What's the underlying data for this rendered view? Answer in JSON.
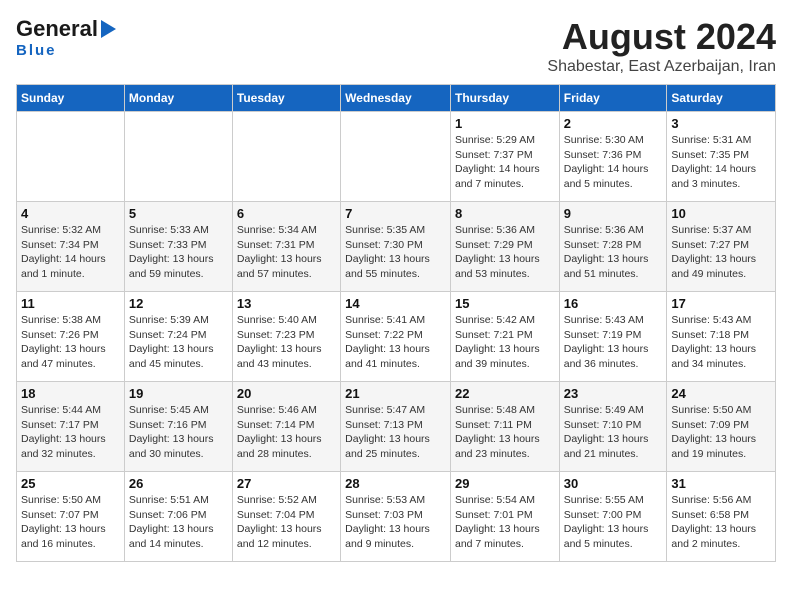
{
  "logo": {
    "line1": "General",
    "line2": "Blue"
  },
  "header": {
    "title": "August 2024",
    "subtitle": "Shabestar, East Azerbaijan, Iran"
  },
  "days_of_week": [
    "Sunday",
    "Monday",
    "Tuesday",
    "Wednesday",
    "Thursday",
    "Friday",
    "Saturday"
  ],
  "weeks": [
    [
      {
        "day": "",
        "info": ""
      },
      {
        "day": "",
        "info": ""
      },
      {
        "day": "",
        "info": ""
      },
      {
        "day": "",
        "info": ""
      },
      {
        "day": "1",
        "info": "Sunrise: 5:29 AM\nSunset: 7:37 PM\nDaylight: 14 hours\nand 7 minutes."
      },
      {
        "day": "2",
        "info": "Sunrise: 5:30 AM\nSunset: 7:36 PM\nDaylight: 14 hours\nand 5 minutes."
      },
      {
        "day": "3",
        "info": "Sunrise: 5:31 AM\nSunset: 7:35 PM\nDaylight: 14 hours\nand 3 minutes."
      }
    ],
    [
      {
        "day": "4",
        "info": "Sunrise: 5:32 AM\nSunset: 7:34 PM\nDaylight: 14 hours\nand 1 minute."
      },
      {
        "day": "5",
        "info": "Sunrise: 5:33 AM\nSunset: 7:33 PM\nDaylight: 13 hours\nand 59 minutes."
      },
      {
        "day": "6",
        "info": "Sunrise: 5:34 AM\nSunset: 7:31 PM\nDaylight: 13 hours\nand 57 minutes."
      },
      {
        "day": "7",
        "info": "Sunrise: 5:35 AM\nSunset: 7:30 PM\nDaylight: 13 hours\nand 55 minutes."
      },
      {
        "day": "8",
        "info": "Sunrise: 5:36 AM\nSunset: 7:29 PM\nDaylight: 13 hours\nand 53 minutes."
      },
      {
        "day": "9",
        "info": "Sunrise: 5:36 AM\nSunset: 7:28 PM\nDaylight: 13 hours\nand 51 minutes."
      },
      {
        "day": "10",
        "info": "Sunrise: 5:37 AM\nSunset: 7:27 PM\nDaylight: 13 hours\nand 49 minutes."
      }
    ],
    [
      {
        "day": "11",
        "info": "Sunrise: 5:38 AM\nSunset: 7:26 PM\nDaylight: 13 hours\nand 47 minutes."
      },
      {
        "day": "12",
        "info": "Sunrise: 5:39 AM\nSunset: 7:24 PM\nDaylight: 13 hours\nand 45 minutes."
      },
      {
        "day": "13",
        "info": "Sunrise: 5:40 AM\nSunset: 7:23 PM\nDaylight: 13 hours\nand 43 minutes."
      },
      {
        "day": "14",
        "info": "Sunrise: 5:41 AM\nSunset: 7:22 PM\nDaylight: 13 hours\nand 41 minutes."
      },
      {
        "day": "15",
        "info": "Sunrise: 5:42 AM\nSunset: 7:21 PM\nDaylight: 13 hours\nand 39 minutes."
      },
      {
        "day": "16",
        "info": "Sunrise: 5:43 AM\nSunset: 7:19 PM\nDaylight: 13 hours\nand 36 minutes."
      },
      {
        "day": "17",
        "info": "Sunrise: 5:43 AM\nSunset: 7:18 PM\nDaylight: 13 hours\nand 34 minutes."
      }
    ],
    [
      {
        "day": "18",
        "info": "Sunrise: 5:44 AM\nSunset: 7:17 PM\nDaylight: 13 hours\nand 32 minutes."
      },
      {
        "day": "19",
        "info": "Sunrise: 5:45 AM\nSunset: 7:16 PM\nDaylight: 13 hours\nand 30 minutes."
      },
      {
        "day": "20",
        "info": "Sunrise: 5:46 AM\nSunset: 7:14 PM\nDaylight: 13 hours\nand 28 minutes."
      },
      {
        "day": "21",
        "info": "Sunrise: 5:47 AM\nSunset: 7:13 PM\nDaylight: 13 hours\nand 25 minutes."
      },
      {
        "day": "22",
        "info": "Sunrise: 5:48 AM\nSunset: 7:11 PM\nDaylight: 13 hours\nand 23 minutes."
      },
      {
        "day": "23",
        "info": "Sunrise: 5:49 AM\nSunset: 7:10 PM\nDaylight: 13 hours\nand 21 minutes."
      },
      {
        "day": "24",
        "info": "Sunrise: 5:50 AM\nSunset: 7:09 PM\nDaylight: 13 hours\nand 19 minutes."
      }
    ],
    [
      {
        "day": "25",
        "info": "Sunrise: 5:50 AM\nSunset: 7:07 PM\nDaylight: 13 hours\nand 16 minutes."
      },
      {
        "day": "26",
        "info": "Sunrise: 5:51 AM\nSunset: 7:06 PM\nDaylight: 13 hours\nand 14 minutes."
      },
      {
        "day": "27",
        "info": "Sunrise: 5:52 AM\nSunset: 7:04 PM\nDaylight: 13 hours\nand 12 minutes."
      },
      {
        "day": "28",
        "info": "Sunrise: 5:53 AM\nSunset: 7:03 PM\nDaylight: 13 hours\nand 9 minutes."
      },
      {
        "day": "29",
        "info": "Sunrise: 5:54 AM\nSunset: 7:01 PM\nDaylight: 13 hours\nand 7 minutes."
      },
      {
        "day": "30",
        "info": "Sunrise: 5:55 AM\nSunset: 7:00 PM\nDaylight: 13 hours\nand 5 minutes."
      },
      {
        "day": "31",
        "info": "Sunrise: 5:56 AM\nSunset: 6:58 PM\nDaylight: 13 hours\nand 2 minutes."
      }
    ]
  ]
}
